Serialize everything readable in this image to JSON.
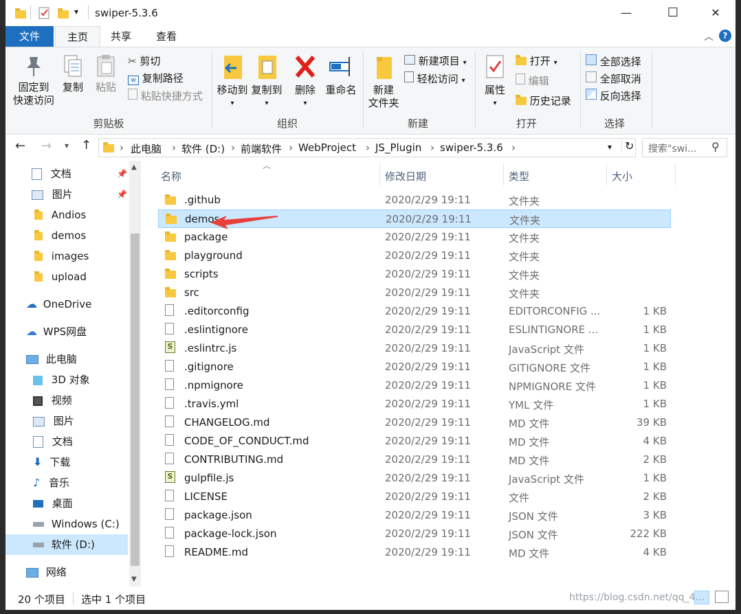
{
  "window": {
    "title": "swiper-5.3.6",
    "buttons": {
      "minimize": "—",
      "maximize": "☐",
      "close": "✕"
    }
  },
  "ribbon_tabs": [
    {
      "label": "文件"
    },
    {
      "label": "主页"
    },
    {
      "label": "共享"
    },
    {
      "label": "查看"
    }
  ],
  "ribbon": {
    "clipboard": {
      "title": "剪贴板",
      "pin": "固定到\n快速访问",
      "pin_l1": "固定到",
      "pin_l2": "快速访问",
      "copy": "复制",
      "paste": "粘贴",
      "cut": "剪切",
      "copy_path": "复制路径",
      "paste_shortcut": "粘贴快捷方式"
    },
    "organize": {
      "title": "组织",
      "move_to": "移动到",
      "copy_to": "复制到",
      "delete": "删除",
      "rename": "重命名"
    },
    "new": {
      "title": "新建",
      "new_folder_l1": "新建",
      "new_folder_l2": "文件夹",
      "new_item": "新建项目",
      "easy_access": "轻松访问"
    },
    "open": {
      "title": "打开",
      "properties": "属性",
      "open": "打开",
      "edit": "编辑",
      "history": "历史记录"
    },
    "select": {
      "title": "选择",
      "select_all": "全部选择",
      "select_none": "全部取消",
      "invert": "反向选择"
    }
  },
  "address": {
    "crumbs": [
      "此电脑",
      "软件 (D:)",
      "前端软件",
      "WebProject",
      "JS_Plugin",
      "swiper-5.3.6"
    ],
    "search_placeholder": "搜索\"swi..."
  },
  "sidebar": {
    "items": [
      {
        "label": "文档",
        "icon": "documents-icon"
      },
      {
        "label": "图片",
        "icon": "pictures-icon"
      },
      {
        "label": "Andios",
        "icon": "folder-icon"
      },
      {
        "label": "demos",
        "icon": "folder-icon"
      },
      {
        "label": "images",
        "icon": "folder-icon"
      },
      {
        "label": "upload",
        "icon": "folder-icon"
      },
      {
        "label": "OneDrive",
        "icon": "cloud-icon"
      },
      {
        "label": "WPS网盘",
        "icon": "cloud-icon"
      },
      {
        "label": "此电脑",
        "icon": "computer-icon"
      },
      {
        "label": "3D 对象",
        "icon": "3d-objects-icon"
      },
      {
        "label": "视频",
        "icon": "video-icon"
      },
      {
        "label": "图片",
        "icon": "pictures-icon"
      },
      {
        "label": "文档",
        "icon": "documents-icon"
      },
      {
        "label": "下载",
        "icon": "download-icon"
      },
      {
        "label": "音乐",
        "icon": "music-icon"
      },
      {
        "label": "桌面",
        "icon": "desktop-icon"
      },
      {
        "label": "Windows (C:)",
        "icon": "drive-icon"
      },
      {
        "label": "软件 (D:)",
        "icon": "drive-icon"
      },
      {
        "label": "网络",
        "icon": "network-icon"
      }
    ]
  },
  "columns": {
    "name": "名称",
    "date": "修改日期",
    "type": "类型",
    "size": "大小"
  },
  "files": [
    {
      "name": ".github",
      "date": "2020/2/29 19:11",
      "type": "文件夹",
      "size": "",
      "kind": "folder"
    },
    {
      "name": "demos",
      "date": "2020/2/29 19:11",
      "type": "文件夹",
      "size": "",
      "kind": "folder",
      "selected": true
    },
    {
      "name": "package",
      "date": "2020/2/29 19:11",
      "type": "文件夹",
      "size": "",
      "kind": "folder"
    },
    {
      "name": "playground",
      "date": "2020/2/29 19:11",
      "type": "文件夹",
      "size": "",
      "kind": "folder"
    },
    {
      "name": "scripts",
      "date": "2020/2/29 19:11",
      "type": "文件夹",
      "size": "",
      "kind": "folder"
    },
    {
      "name": "src",
      "date": "2020/2/29 19:11",
      "type": "文件夹",
      "size": "",
      "kind": "folder"
    },
    {
      "name": ".editorconfig",
      "date": "2020/2/29 19:11",
      "type": "EDITORCONFIG ...",
      "size": "1 KB",
      "kind": "file"
    },
    {
      "name": ".eslintignore",
      "date": "2020/2/29 19:11",
      "type": "ESLINTIGNORE ...",
      "size": "1 KB",
      "kind": "file"
    },
    {
      "name": ".eslintrc.js",
      "date": "2020/2/29 19:11",
      "type": "JavaScript 文件",
      "size": "1 KB",
      "kind": "js"
    },
    {
      "name": ".gitignore",
      "date": "2020/2/29 19:11",
      "type": "GITIGNORE 文件",
      "size": "1 KB",
      "kind": "file"
    },
    {
      "name": ".npmignore",
      "date": "2020/2/29 19:11",
      "type": "NPMIGNORE 文件",
      "size": "1 KB",
      "kind": "file"
    },
    {
      "name": ".travis.yml",
      "date": "2020/2/29 19:11",
      "type": "YML 文件",
      "size": "1 KB",
      "kind": "file"
    },
    {
      "name": "CHANGELOG.md",
      "date": "2020/2/29 19:11",
      "type": "MD 文件",
      "size": "39 KB",
      "kind": "file"
    },
    {
      "name": "CODE_OF_CONDUCT.md",
      "date": "2020/2/29 19:11",
      "type": "MD 文件",
      "size": "4 KB",
      "kind": "file"
    },
    {
      "name": "CONTRIBUTING.md",
      "date": "2020/2/29 19:11",
      "type": "MD 文件",
      "size": "2 KB",
      "kind": "file"
    },
    {
      "name": "gulpfile.js",
      "date": "2020/2/29 19:11",
      "type": "JavaScript 文件",
      "size": "1 KB",
      "kind": "js"
    },
    {
      "name": "LICENSE",
      "date": "2020/2/29 19:11",
      "type": "文件",
      "size": "2 KB",
      "kind": "file"
    },
    {
      "name": "package.json",
      "date": "2020/2/29 19:11",
      "type": "JSON 文件",
      "size": "3 KB",
      "kind": "file"
    },
    {
      "name": "package-lock.json",
      "date": "2020/2/29 19:11",
      "type": "JSON 文件",
      "size": "222 KB",
      "kind": "file"
    },
    {
      "name": "README.md",
      "date": "2020/2/29 19:11",
      "type": "MD 文件",
      "size": "4 KB",
      "kind": "file"
    }
  ],
  "status": {
    "count": "20 个项目",
    "selected": "选中 1 个项目"
  },
  "watermark": "https://blog.csdn.net/qq_4...",
  "colors": {
    "accent": "#1e6fbf",
    "selection": "#cce8ff",
    "arrow": "#e8403a"
  }
}
